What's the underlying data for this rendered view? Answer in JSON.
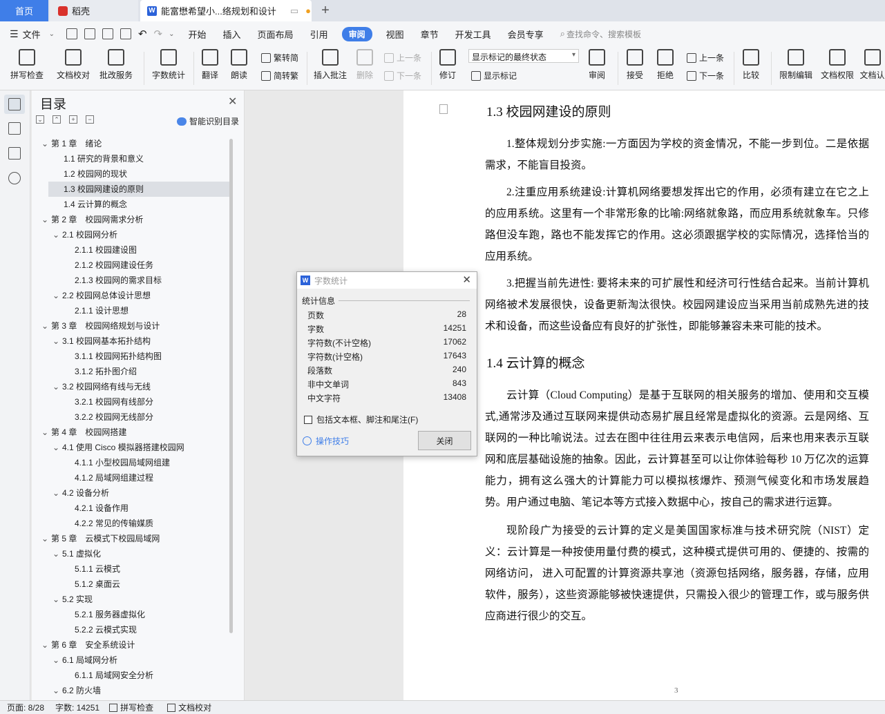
{
  "tabs": {
    "home": "首页",
    "daoke": "稻壳",
    "doc": "能富懋希望小...络规划和设计",
    "new_tab": "+"
  },
  "menubar": {
    "file": "文件",
    "items": [
      "开始",
      "插入",
      "页面布局",
      "引用",
      "审阅",
      "视图",
      "章节",
      "开发工具",
      "会员专享"
    ],
    "active": "审阅",
    "search": "查找命令、搜索模板"
  },
  "ribbon": {
    "spell": "拼写检查",
    "proof": "文档校对",
    "review_service": "批改服务",
    "word_count": "字数统计",
    "translate": "翻译",
    "read": "朗读",
    "trad": "繁转简",
    "simp": "简转繁",
    "insert_comment": "插入批注",
    "delete": "删除",
    "prev_comment": "上一条",
    "next_comment": "下一条",
    "track": "修订",
    "show_state": "显示标记的最终状态",
    "show_markup": "显示标记",
    "review": "审阅",
    "accept": "接受",
    "reject": "拒绝",
    "prev": "上一条",
    "next": "下一条",
    "compare": "比较",
    "restrict": "限制编辑",
    "permission": "文档权限",
    "auth": "文档认"
  },
  "toc": {
    "title": "目录",
    "smart": "智能识别目录",
    "items": [
      {
        "text": "第 1 章　绪论",
        "level": 1
      },
      {
        "text": "1.1  研究的背景和意义",
        "level": 2
      },
      {
        "text": "1.2  校园网的现状",
        "level": 2
      },
      {
        "text": "1.3  校园网建设的原则",
        "level": 2,
        "selected": true
      },
      {
        "text": "1.4  云计算的概念",
        "level": 2
      },
      {
        "text": "第 2 章　校园网需求分析",
        "level": 1
      },
      {
        "text": "2.1  校园网分析",
        "level": 2,
        "expand": true
      },
      {
        "text": "2.1.1  校园建设图",
        "level": 3
      },
      {
        "text": "2.1.2  校园网建设任务",
        "level": 3
      },
      {
        "text": "2.1.3  校园网的需求目标",
        "level": 3
      },
      {
        "text": "2.2  校园网总体设计思想",
        "level": 2,
        "expand": true
      },
      {
        "text": "2.1.1  设计思想",
        "level": 3
      },
      {
        "text": "第 3 章　校园网络规划与设计",
        "level": 1
      },
      {
        "text": "3.1  校园网基本拓扑结构",
        "level": 2,
        "expand": true
      },
      {
        "text": "3.1.1  校园网拓扑结构图",
        "level": 3
      },
      {
        "text": "3.1.2  拓扑图介绍",
        "level": 3
      },
      {
        "text": "3.2  校园网络有线与无线",
        "level": 2,
        "expand": true
      },
      {
        "text": "3.2.1  校园网有线部分",
        "level": 3
      },
      {
        "text": "3.2.2  校园网无线部分",
        "level": 3
      },
      {
        "text": "第 4 章　校园网搭建",
        "level": 1
      },
      {
        "text": "4.1  使用 Cisco 模拟器搭建校园网",
        "level": 2,
        "expand": true
      },
      {
        "text": "4.1.1  小型校园局域网组建",
        "level": 3
      },
      {
        "text": "4.1.2  局域网组建过程",
        "level": 3
      },
      {
        "text": "4.2  设备分析",
        "level": 2,
        "expand": true
      },
      {
        "text": "4.2.1 设备作用",
        "level": 3
      },
      {
        "text": "4.2.2 常见的传输媒质",
        "level": 3
      },
      {
        "text": "第 5 章　云模式下校园局域网",
        "level": 1
      },
      {
        "text": "5.1  虚拟化",
        "level": 2,
        "expand": true
      },
      {
        "text": "5.1.1  云模式",
        "level": 3
      },
      {
        "text": "5.1.2  桌面云",
        "level": 3
      },
      {
        "text": "5.2  实现",
        "level": 2,
        "expand": true
      },
      {
        "text": "5.2.1  服务器虚拟化",
        "level": 3
      },
      {
        "text": "5.2.2  云模式实现",
        "level": 3
      },
      {
        "text": "第 6 章　安全系统设计",
        "level": 1
      },
      {
        "text": "6.1  局域网分析",
        "level": 2,
        "expand": true
      },
      {
        "text": "6.1.1  局域网安全分析",
        "level": 3
      },
      {
        "text": "6.2  防火墙",
        "level": 2,
        "expand": true
      }
    ]
  },
  "document": {
    "h_1_3": "1.3  校园网建设的原则",
    "p1": "1.整体规划分步实施:一方面因为学校的资金情况，不能一步到位。二是依据需求，不能盲目投资。",
    "p2": "2.注重应用系统建设:计算机网络要想发挥出它的作用，必须有建立在它之上的应用系统。这里有一个非常形象的比喻:网络就象路，而应用系统就象车。只修路但没车跑，路也不能发挥它的作用。这必须跟据学校的实际情况，选择恰当的应用系统。",
    "p3": "3.把握当前先进性: 要将未来的可扩展性和经济可行性结合起来。当前计算机网络被术发展很快，设备更新淘汰很快。校园网建设应当采用当前成熟先进的技术和设备，而这些设备应有良好的扩张性，即能够兼容未来可能的技术。",
    "h_1_4": "1.4  云计算的概念",
    "p4": "云计算（Cloud Computing）是基于互联网的相关服务的增加、使用和交互模式,通常涉及通过互联网来提供动态易扩展且经常是虚拟化的资源。云是网络、互联网的一种比喻说法。过去在图中往往用云来表示电信网，后来也用来表示互联网和底层基础设施的抽象。因此，云计算甚至可以让你体验每秒 10 万亿次的运算能力，拥有这么强大的计算能力可以模拟核爆炸、预测气候变化和市场发展趋势。用户通过电脑、笔记本等方式接入数据中心，按自己的需求进行运算。",
    "p5": "现阶段广为接受的云计算的定义是美国国家标准与技术研究院（NIST）定义：云计算是一种按使用量付费的模式，这种模式提供可用的、便捷的、按需的网络访问，  进入可配置的计算资源共享池（资源包括网络，服务器，存储，应用软件，服务），这些资源能够被快速提供，只需投入很少的管理工作，或与服务供应商进行很少的交互。",
    "page_number": "3"
  },
  "dialog": {
    "title": "字数统计",
    "section": "统计信息",
    "stats": [
      {
        "label": "页数",
        "value": "28"
      },
      {
        "label": "字数",
        "value": "14251"
      },
      {
        "label": "字符数(不计空格)",
        "value": "17062"
      },
      {
        "label": "字符数(计空格)",
        "value": "17643"
      },
      {
        "label": "段落数",
        "value": "240"
      },
      {
        "label": "非中文单词",
        "value": "843"
      },
      {
        "label": "中文字符",
        "value": "13408"
      }
    ],
    "include_label": "包括文本框、脚注和尾注(F)",
    "tips": "操作技巧",
    "close": "关闭"
  },
  "status": {
    "page": "页面: 8/28",
    "words": "字数: 14251",
    "spell": "拼写检查",
    "proof": "文档校对"
  }
}
